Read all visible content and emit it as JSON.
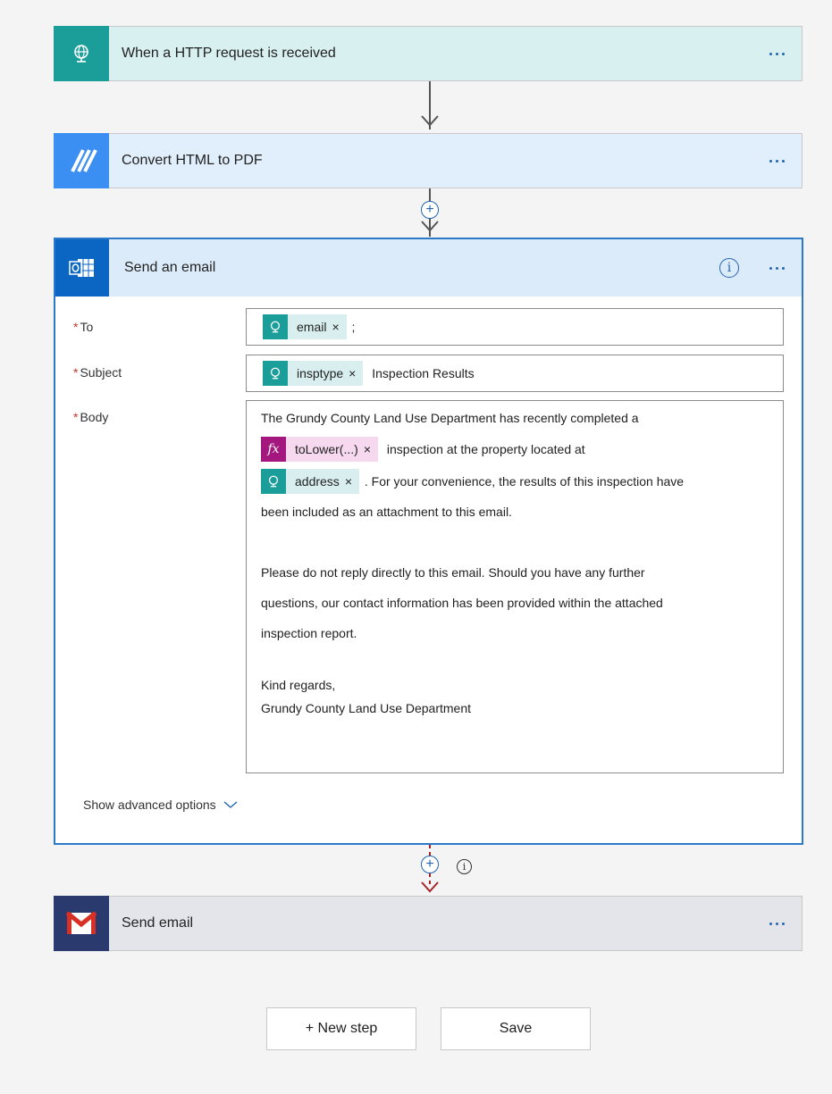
{
  "steps": {
    "http": {
      "title": "When a HTTP request is received",
      "icon": "http-request-icon",
      "color": "#1b9e9a"
    },
    "pdf": {
      "title": "Convert HTML to PDF",
      "icon": "encodian-icon",
      "color": "#3b8ff3"
    },
    "outlook": {
      "title": "Send an email",
      "icon": "outlook-icon",
      "color": "#0a66c2"
    },
    "gmail": {
      "title": "Send email",
      "icon": "gmail-icon",
      "color": "#2a3a6e"
    }
  },
  "form": {
    "to_label": "To",
    "to_token": "email",
    "to_suffix": ";",
    "subject_label": "Subject",
    "subject_token": "insptype",
    "subject_text": "Inspection Results",
    "body_label": "Body",
    "body": {
      "line1": "The Grundy County Land Use Department has recently completed a",
      "fx_token": "toLower(...)",
      "after_fx": "inspection at the property located at",
      "address_token": "address",
      "after_address": ". For your convenience, the results of this inspection have",
      "line4": "been included as an attachment to this email.",
      "para2_line1": "Please do not reply directly to this email. Should you have any further",
      "para2_line2": "questions, our contact information has been provided within the attached",
      "para2_line3": "inspection report.",
      "closing": "Kind regards,",
      "signature": "Grundy County Land Use Department"
    },
    "advanced": "Show advanced options",
    "required_mark": "*",
    "token_remove": "×"
  },
  "buttons": {
    "new_step": "+ New step",
    "save": "Save"
  },
  "colors": {
    "accent": "#2266b4",
    "http_card": "#d9f0f0",
    "pdf_card": "#e1eefb",
    "gmail_card": "#e3e5ea"
  }
}
